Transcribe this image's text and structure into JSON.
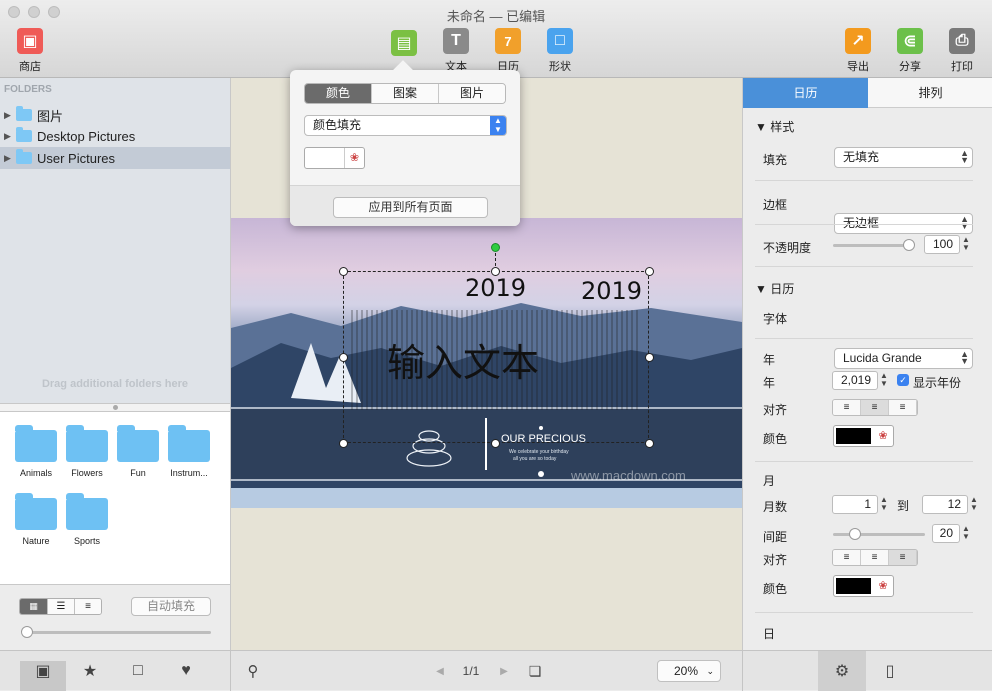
{
  "window": {
    "title": "未命名 — 已编辑",
    "watermark": "www.MacDown.com"
  },
  "toolbar": {
    "store": "商店",
    "fill": "填充",
    "text": "文本",
    "calendar": "日历",
    "calendar_day": "7",
    "shape": "形状",
    "export": "导出",
    "share": "分享",
    "print": "打印"
  },
  "sidebar": {
    "header": "FOLDERS",
    "tree": [
      {
        "label": "图片"
      },
      {
        "label": "Desktop Pictures"
      },
      {
        "label": "User Pictures"
      }
    ],
    "drag_hint": "Drag additional folders here",
    "folders": [
      {
        "label": "Animals"
      },
      {
        "label": "Flowers"
      },
      {
        "label": "Fun"
      },
      {
        "label": "Instrum..."
      },
      {
        "label": "Nature"
      },
      {
        "label": "Sports"
      }
    ],
    "autofill": "自动填充"
  },
  "popover": {
    "tabs": [
      "颜色",
      "图案",
      "图片"
    ],
    "fill_type": "颜色填充",
    "apply_all": "应用到所有页面"
  },
  "canvas": {
    "year_left": "2019",
    "year_right": "2019",
    "placeholder": "输入文本",
    "banner_title": "OUR PRECIOUS",
    "banner_sub1": "We celebrate your birthday",
    "banner_sub2": "all you are so today",
    "watermark": "www.macdown.com"
  },
  "inspector": {
    "tabs": [
      "日历",
      "排列"
    ],
    "style_section": "样式",
    "fill_label": "填充",
    "fill_value": "无填充",
    "border_label": "边框",
    "border_value": "无边框",
    "opacity_label": "不透明度",
    "opacity_value": "100",
    "opacity_level": 1.0,
    "calendar_section": "日历",
    "font_label": "字体",
    "font_value": "Lucida Grande",
    "year_section": "年",
    "year_label": "年",
    "year_value": "2,019",
    "show_year": "显示年份",
    "align_label": "对齐",
    "color_label": "颜色",
    "month_section": "月",
    "months_label": "月数",
    "month_from": "1",
    "month_to_label": "到",
    "month_to": "12",
    "spacing_label": "间距",
    "spacing_value": "20",
    "month_align_label": "对齐",
    "month_color_label": "颜色",
    "day_section": "日",
    "accent_color": "#4a90d9"
  },
  "bottombar": {
    "page": "1/1",
    "zoom": "20%"
  }
}
